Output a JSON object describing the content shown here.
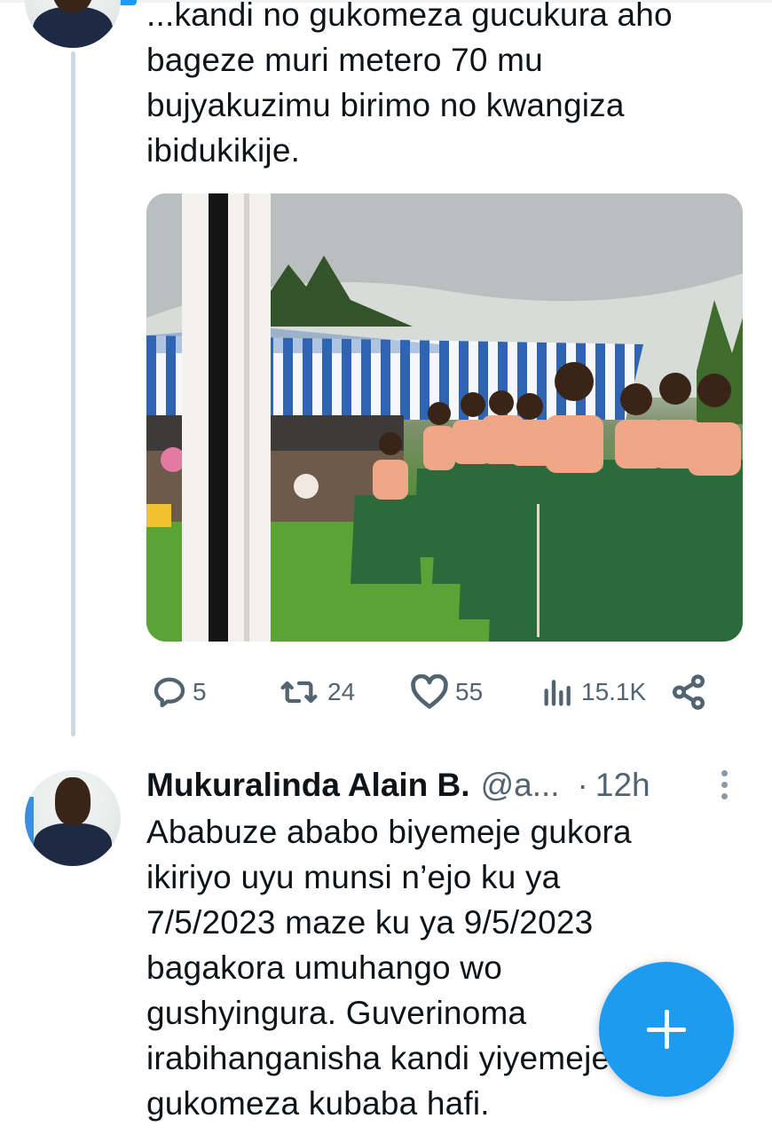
{
  "colors": {
    "accent": "#1d9bf0",
    "text": "#0f1419",
    "muted": "#536471",
    "thread_line": "#cfd9de"
  },
  "tweet1": {
    "avatar_icon": "profile-photo",
    "text": "...kandi no gukomeza gucukura aho\nbageze muri metero 70 mu\nbujyakuzimu birimo no kwangiza\nibidukikije.",
    "media": {
      "kind": "photo"
    },
    "actions": {
      "reply": {
        "icon": "reply-icon",
        "count": "5"
      },
      "retweet": {
        "icon": "retweet-icon",
        "count": "24"
      },
      "like": {
        "icon": "heart-icon",
        "count": "55"
      },
      "views": {
        "icon": "views-icon",
        "count": "15.1K"
      },
      "share": {
        "icon": "share-icon"
      }
    }
  },
  "tweet2": {
    "author": "Mukuralinda Alain B.",
    "handle": "@a...",
    "separator": "·",
    "time": "12h",
    "text": "Ababuze ababo biyemeje gukora\nikiriyo uyu munsi n’ejo ku ya\n7/5/2023 maze ku ya 9/5/2023\nbagakora umuhango wo\ngushyingura. Guverinoma\nirabihanganisha kandi yiyemeje\ngukomeza kubaba hafi."
  },
  "fab": {
    "icon": "plus-icon",
    "label": "New post"
  }
}
